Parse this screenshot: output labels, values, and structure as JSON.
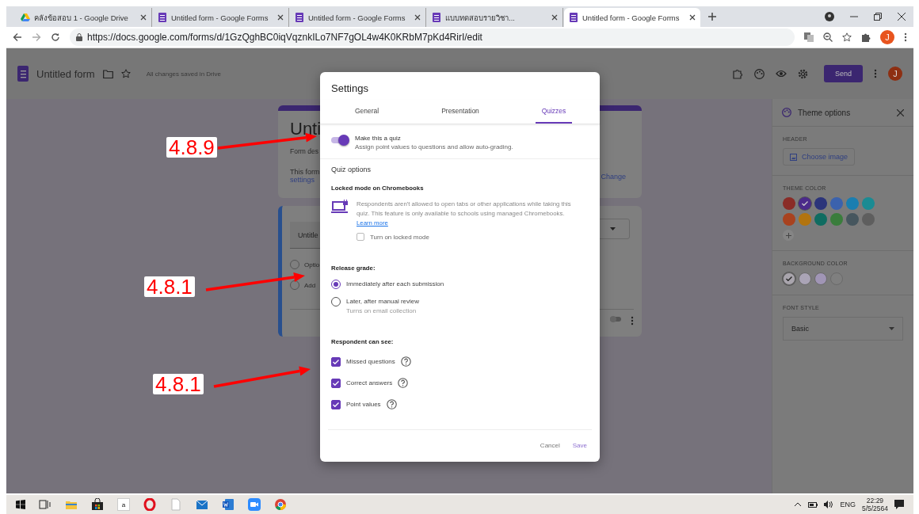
{
  "browser_tabs": [
    {
      "kind": "drive",
      "title": "คลังข้อสอบ 1 - Google Drive",
      "selected": false
    },
    {
      "kind": "forms",
      "title": "Untitled form - Google Forms",
      "selected": false
    },
    {
      "kind": "forms",
      "title": "Untitled form - Google Forms",
      "selected": false
    },
    {
      "kind": "forms",
      "title": "แบบทดสอบรายวิชา...",
      "selected": false
    },
    {
      "kind": "forms",
      "title": "Untitled form - Google Forms",
      "selected": true
    }
  ],
  "address_bar": {
    "url": "https://docs.google.com/forms/d/1GzQghBC0iqVqznkILo7NF7gOL4w4K0KRbM7pKd4RirI/edit",
    "avatar": "J"
  },
  "app_header": {
    "title": "Untitled form",
    "save_status": "All changes saved in Drive",
    "send": "Send",
    "avatar": "J"
  },
  "form_background": {
    "title": "Unti",
    "description": "Form des",
    "notice": "This form",
    "notice_link": "settings",
    "change_link": "Change",
    "question": "Untitle",
    "option": "Optio",
    "add_option": "Add"
  },
  "settings_dialog": {
    "title": "Settings",
    "tabs": [
      {
        "label": "General",
        "selected": false
      },
      {
        "label": "Presentation",
        "selected": false
      },
      {
        "label": "Quizzes",
        "selected": true
      }
    ],
    "quiz_toggle": {
      "label": "Make this a quiz",
      "description": "Assign point values to questions and allow auto-grading.",
      "on": true
    },
    "quiz_options_heading": "Quiz options",
    "locked_mode": {
      "heading": "Locked mode on Chromebooks",
      "text": "Respondents aren't allowed to open tabs or other applications while taking this quiz. This feature is only available to schools using managed Chromebooks.",
      "link": "Learn more",
      "checkbox": {
        "label": "Turn on locked mode",
        "checked": false
      }
    },
    "release_grade": {
      "heading": "Release grade:",
      "options": [
        {
          "label": "Immediately after each submission",
          "selected": true
        },
        {
          "label": "Later, after manual review",
          "note": "Turns on email collection",
          "selected": false
        }
      ]
    },
    "respondent_can_see": {
      "heading": "Respondent can see:",
      "options": [
        {
          "label": "Missed questions",
          "checked": true
        },
        {
          "label": "Correct answers",
          "checked": true
        },
        {
          "label": "Point values",
          "checked": true
        }
      ]
    },
    "buttons": [
      "Cancel",
      "Save"
    ]
  },
  "theme_panel": {
    "title": "Theme options",
    "header_label": "HEADER",
    "choose_image": "Choose image",
    "theme_color_label": "THEME COLOR",
    "theme_colors": [
      {
        "color": "#8a2c27",
        "selected": false
      },
      {
        "color": "#4b2a8a",
        "selected": true
      },
      {
        "color": "#2c347a",
        "selected": false
      },
      {
        "color": "#3b62ad",
        "selected": false
      },
      {
        "color": "#1a7eb0",
        "selected": false
      },
      {
        "color": "#1a8b93",
        "selected": false
      },
      {
        "color": "#a8421f",
        "selected": false
      },
      {
        "color": "#b2740f",
        "selected": false
      },
      {
        "color": "#0f6c61",
        "selected": false
      },
      {
        "color": "#3a7d3c",
        "selected": false
      },
      {
        "color": "#46565e",
        "selected": false
      },
      {
        "color": "#5e5e5e",
        "selected": false
      }
    ],
    "background_color_label": "BACKGROUND COLOR",
    "background_colors": [
      {
        "color": "#a9a5ad",
        "selected": true
      },
      {
        "color": "#aaa4b6",
        "selected": false
      },
      {
        "color": "#a095b5",
        "selected": false
      },
      {
        "color": "#7f7f7f",
        "selected": false
      }
    ],
    "font_style_label": "FONT STYLE",
    "font_style": "Basic"
  },
  "annotations": [
    {
      "label": "4.8.9"
    },
    {
      "label": "4.8.1"
    },
    {
      "label": "4.8.1"
    }
  ],
  "taskbar": {
    "apps": [
      {
        "kind": "task-view"
      },
      {
        "kind": "folder"
      },
      {
        "kind": "store"
      },
      {
        "kind": "letter",
        "label": "a"
      },
      {
        "kind": "opera"
      },
      {
        "kind": "file"
      },
      {
        "kind": "mail"
      },
      {
        "kind": "word"
      },
      {
        "kind": "zoom"
      },
      {
        "kind": "chrome"
      }
    ],
    "language": "ENG",
    "time": "22:29",
    "date": "5/5/2564"
  }
}
